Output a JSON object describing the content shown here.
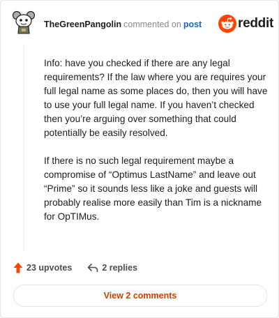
{
  "header": {
    "username": "TheGreenPangolin",
    "action_text": "commented on",
    "link_text": "post",
    "brand_name": "reddit"
  },
  "comment": {
    "paragraphs": [
      "Info: have you checked if there are any legal requirements? If the law where you are requires your full legal name as some places do, then you will have to use your full legal name. If you haven’t checked then you’re arguing over something that could potentially be easily resolved.",
      "If there is no such legal requirement maybe a compromise of “Optimus LastName” and leave out “Prime” so it sounds less like a joke and guests will probably realise more easily than Tim is a nickname for OpTIMus."
    ]
  },
  "footer": {
    "upvotes": "23 upvotes",
    "replies": "2 replies",
    "view_comments": "View 2 comments"
  },
  "colors": {
    "reddit_orange": "#ff4500",
    "link_blue": "#1a64c9",
    "view_button_text": "#d93a00"
  },
  "icons": {
    "upvote": "upvote-arrow-icon",
    "reply": "reply-arrow-icon",
    "brand": "reddit-snoo-icon",
    "avatar": "snoo-avatar"
  }
}
